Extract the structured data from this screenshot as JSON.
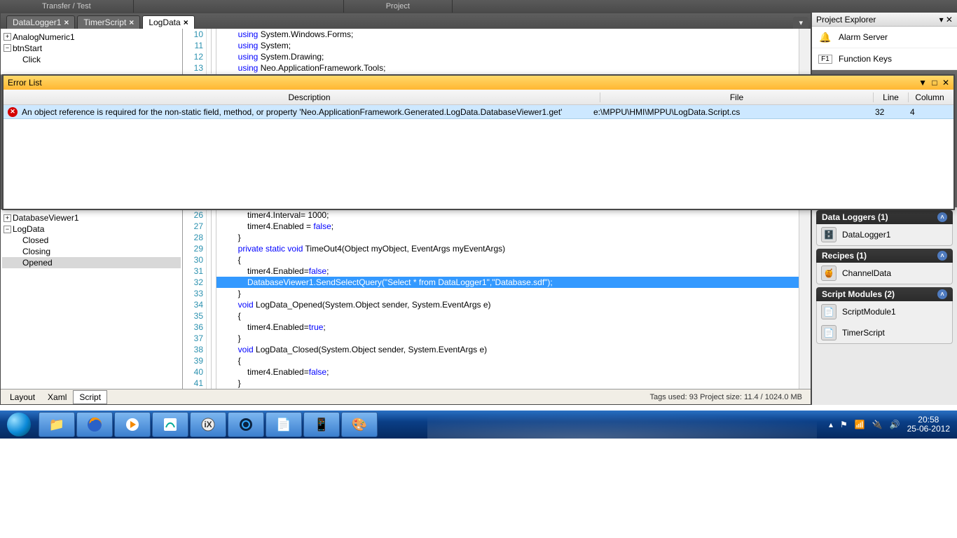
{
  "ribbon": {
    "seg1": "Transfer / Test",
    "seg2": "Project"
  },
  "tabs": [
    {
      "label": "DataLogger1",
      "active": false
    },
    {
      "label": "TimerScript",
      "active": false
    },
    {
      "label": "LogData",
      "active": true
    }
  ],
  "treeTop": [
    {
      "label": "AnalogNumeric1",
      "exp": "+",
      "indent": 0
    },
    {
      "label": "btnStart",
      "exp": "-",
      "indent": 0
    },
    {
      "label": "Click",
      "exp": "",
      "indent": 1
    }
  ],
  "treeBottom": [
    {
      "label": "DatabaseViewer1",
      "exp": "+",
      "indent": 0
    },
    {
      "label": "LogData",
      "exp": "-",
      "indent": 0
    },
    {
      "label": "Closed",
      "exp": "",
      "indent": 1,
      "sel": false
    },
    {
      "label": "Closing",
      "exp": "",
      "indent": 1,
      "sel": false
    },
    {
      "label": "Opened",
      "exp": "",
      "indent": 1,
      "sel": true
    }
  ],
  "codeTop": [
    {
      "n": 10,
      "t": "        using System.Windows.Forms;",
      "kwEnd": 13
    },
    {
      "n": 11,
      "t": "        using System;",
      "kwEnd": 13
    },
    {
      "n": 12,
      "t": "        using System.Drawing;",
      "kwEnd": 13
    },
    {
      "n": 13,
      "t": "        using Neo.ApplicationFramework.Tools;",
      "kwEnd": 13
    }
  ],
  "codeBottom": [
    {
      "n": 26,
      "t": "            timer4.Interval= 1000;"
    },
    {
      "n": 27,
      "t": "            timer4.Enabled = false;",
      "fw": "false"
    },
    {
      "n": 28,
      "t": "        }"
    },
    {
      "n": 29,
      "t": "        private static void TimeOut4(Object myObject, EventArgs myEventArgs)",
      "kws": [
        "private",
        "static",
        "void"
      ]
    },
    {
      "n": 30,
      "t": "        {"
    },
    {
      "n": 31,
      "t": "            timer4.Enabled=false;",
      "fw": "false"
    },
    {
      "n": 32,
      "hl": true,
      "t": "            DatabaseViewer1.SendSelectQuery(\"Select * from DataLogger1\",\"Database.sdf\");"
    },
    {
      "n": 33,
      "t": "        }"
    },
    {
      "n": 34,
      "t": "        void LogData_Opened(System.Object sender, System.EventArgs e)",
      "kws": [
        "void"
      ]
    },
    {
      "n": 35,
      "t": "        {"
    },
    {
      "n": 36,
      "t": "            timer4.Enabled=true;",
      "fw": "true"
    },
    {
      "n": 37,
      "t": "        }"
    },
    {
      "n": 38,
      "t": "        void LogData_Closed(System.Object sender, System.EventArgs e)",
      "kws": [
        "void"
      ]
    },
    {
      "n": 39,
      "t": "        {"
    },
    {
      "n": 40,
      "t": "            timer4.Enabled=false;",
      "fw": "false"
    },
    {
      "n": 41,
      "t": "        }"
    }
  ],
  "errorPanel": {
    "title": "Error List",
    "cols": {
      "desc": "Description",
      "file": "File",
      "line": "Line",
      "col": "Column"
    },
    "row": {
      "desc": "An object reference is required for the non-static field, method, or property 'Neo.ApplicationFramework.Generated.LogData.DatabaseViewer1.get'",
      "file": "e:\\MPPU\\HMI\\MPPU\\LogData.Script.cs",
      "line": "32",
      "col": "4"
    }
  },
  "projectExplorer": {
    "title": "Project Explorer",
    "items": [
      {
        "icon": "bell",
        "label": "Alarm Server"
      },
      {
        "icon": "f1",
        "label": "Function Keys"
      }
    ]
  },
  "groups": [
    {
      "title": "Data Loggers (1)",
      "items": [
        {
          "icon": "db",
          "label": "DataLogger1"
        }
      ]
    },
    {
      "title": "Recipes (1)",
      "items": [
        {
          "icon": "recipe",
          "label": "ChannelData"
        }
      ]
    },
    {
      "title": "Script Modules (2)",
      "items": [
        {
          "icon": "script",
          "label": "ScriptModule1"
        },
        {
          "icon": "script",
          "label": "TimerScript"
        }
      ]
    }
  ],
  "bottomTabs": {
    "tabs": [
      "Layout",
      "Xaml",
      "Script"
    ],
    "active": 2,
    "status": "Tags used: 93  Project size: 11.4 / 1024.0 MB"
  },
  "tray": {
    "time": "20:58",
    "date": "25-06-2012"
  }
}
